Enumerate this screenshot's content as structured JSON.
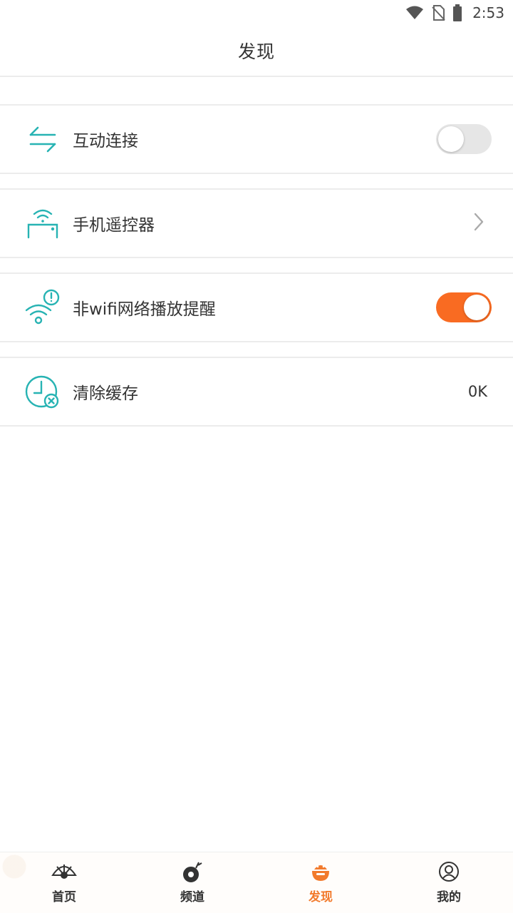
{
  "status_bar": {
    "time": "2:53",
    "icons": [
      "wifi-icon",
      "no-sim-icon",
      "battery-icon"
    ]
  },
  "header": {
    "title": "发现"
  },
  "settings": [
    {
      "label": "互动连接",
      "icon": "swap-arrows-icon",
      "control": "toggle",
      "on": false
    },
    {
      "label": "手机遥控器",
      "icon": "remote-wifi-icon",
      "control": "chevron"
    },
    {
      "label": "非wifi网络播放提醒",
      "icon": "wifi-alert-icon",
      "control": "toggle",
      "on": true
    },
    {
      "label": "清除缓存",
      "icon": "clock-clear-icon",
      "control": "value",
      "value": "0K"
    }
  ],
  "bottom_nav": {
    "items": [
      {
        "label": "首页",
        "icon": "fan-home-icon",
        "active": false
      },
      {
        "label": "频道",
        "icon": "channel-icon",
        "active": false
      },
      {
        "label": "发现",
        "icon": "discover-icon",
        "active": true
      },
      {
        "label": "我的",
        "icon": "user-icon",
        "active": false
      }
    ]
  },
  "colors": {
    "accent": "#f96b22",
    "teal": "#27b3b3",
    "nav_active": "#f27a2c"
  }
}
